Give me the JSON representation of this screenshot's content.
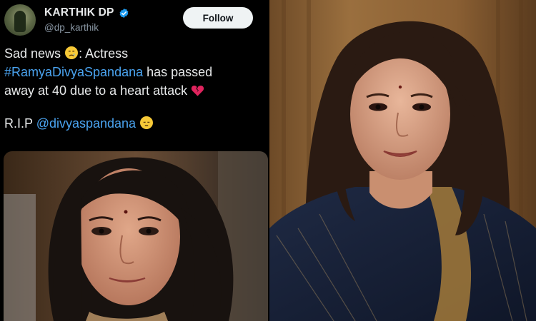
{
  "tweet": {
    "display_name": "KARTHIK DP",
    "handle": "@dp_karthik",
    "follow_label": "Follow",
    "text": {
      "line1_prefix": "Sad news",
      "line1_suffix": ": Actress",
      "hashtag": "#RamyaDivyaSpandana",
      "line2_rest": " has passed",
      "line3": "away at 40 due to a heart attack",
      "rip_prefix": "R.I.P ",
      "mention": "@divyaspandana"
    },
    "icons": {
      "verified": "verified-badge-icon",
      "crying_face": "crying-face-emoji",
      "broken_heart": "broken-heart-emoji",
      "pensive_face": "pensive-face-emoji"
    },
    "colors": {
      "link": "#4aa3ef",
      "verified": "#1d9bf0",
      "background": "#000000"
    }
  },
  "images": {
    "tweet_media": "selfie photo of a woman with shoulder-length dark hair",
    "portrait": "portrait of a smiling woman in a dark blue saree with gold border"
  }
}
